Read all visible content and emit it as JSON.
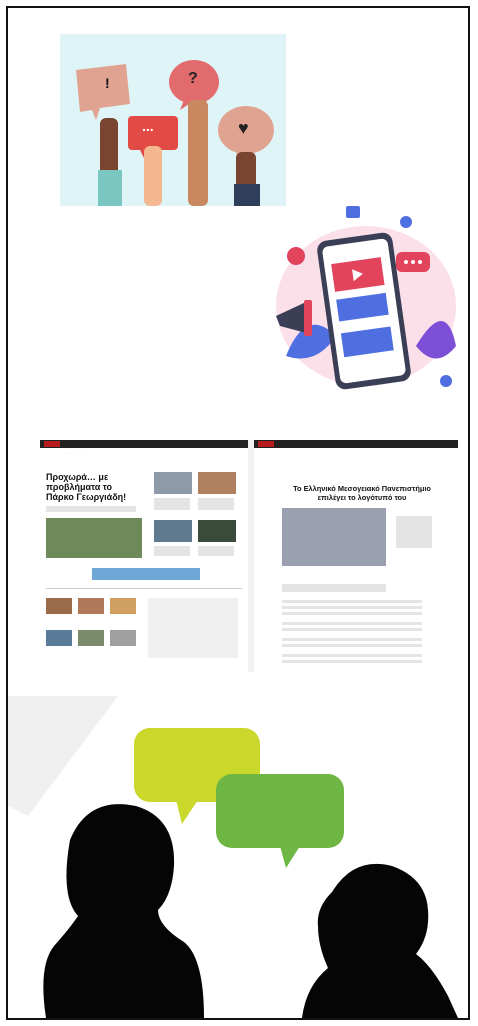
{
  "panels": [
    {
      "name": "speech-bubbles-hands-illustration",
      "symbols": [
        "!",
        "...",
        "?",
        "♥"
      ]
    },
    {
      "name": "social-media-phone-illustration"
    },
    {
      "name": "news-website-screenshots"
    },
    {
      "name": "two-people-silhouette-conversation"
    }
  ],
  "news_left": {
    "headline_line1": "Προχωρά… με",
    "headline_line2": "προβλήματα το",
    "headline_line3": "Πάρκο Γεωργιάδη!"
  },
  "news_right": {
    "headline_line1": "Το Ελληνικό Μεσογειακό Πανεπιστήμιο",
    "headline_line2": "επιλέγει το λογότυπό του"
  },
  "colors": {
    "bubble_yellow": "#c9d82a",
    "bubble_green": "#6fb744",
    "news_red": "#b71c1c"
  }
}
